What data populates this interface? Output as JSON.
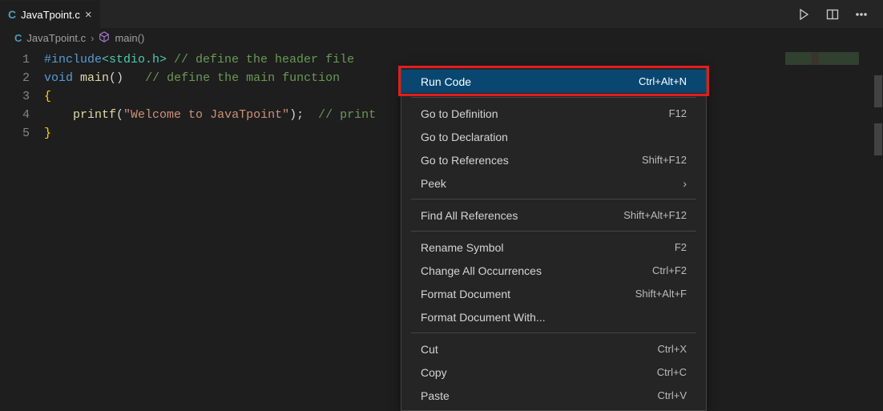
{
  "tab": {
    "filename": "JavaTpoint.c"
  },
  "breadcrumb": {
    "filename": "JavaTpoint.c",
    "symbol": "main()"
  },
  "gutter": [
    "1",
    "2",
    "3",
    "4",
    "5"
  ],
  "code": {
    "l1_pre": "#include",
    "l1_tag": "<stdio.h>",
    "l1_cmt": " // define the header file",
    "l2_kw1": "void",
    "l2_fn": " main",
    "l2_paren": "()",
    "l2_space": "   ",
    "l2_cmt": "// define the main function",
    "l3": "{",
    "l4_indent": "    ",
    "l4_fn": "printf",
    "l4_open": "(",
    "l4_str": "\"Welcome to JavaTpoint\"",
    "l4_close": ");",
    "l4_sp": "  ",
    "l4_cmt": "// print",
    "l5": "}"
  },
  "menu": {
    "run_code": {
      "label": "Run Code",
      "shortcut": "Ctrl+Alt+N"
    },
    "go_def": {
      "label": "Go to Definition",
      "shortcut": "F12"
    },
    "go_decl": {
      "label": "Go to Declaration",
      "shortcut": ""
    },
    "go_ref": {
      "label": "Go to References",
      "shortcut": "Shift+F12"
    },
    "peek": {
      "label": "Peek"
    },
    "find_ref": {
      "label": "Find All References",
      "shortcut": "Shift+Alt+F12"
    },
    "rename": {
      "label": "Rename Symbol",
      "shortcut": "F2"
    },
    "change": {
      "label": "Change All Occurrences",
      "shortcut": "Ctrl+F2"
    },
    "fmt": {
      "label": "Format Document",
      "shortcut": "Shift+Alt+F"
    },
    "fmtw": {
      "label": "Format Document With..."
    },
    "cut": {
      "label": "Cut",
      "shortcut": "Ctrl+X"
    },
    "copy": {
      "label": "Copy",
      "shortcut": "Ctrl+C"
    },
    "paste": {
      "label": "Paste",
      "shortcut": "Ctrl+V"
    }
  }
}
